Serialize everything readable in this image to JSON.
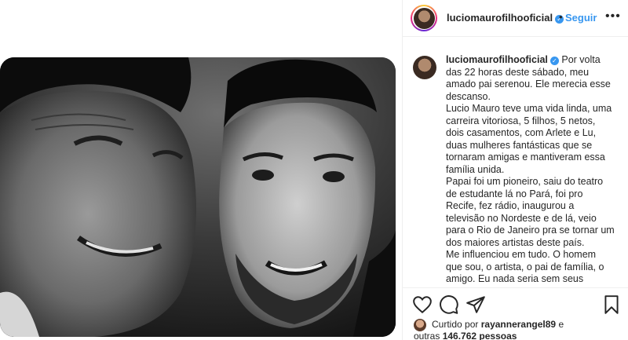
{
  "post": {
    "username": "luciomaurofilhooficial",
    "separator": "•",
    "follow_label": "Seguir",
    "more_label": "•••"
  },
  "caption": {
    "username": "luciomaurofilhooficial",
    "first_line": "Por volta",
    "lines": [
      "das 22 horas deste sábado, meu",
      "amado pai serenou. Ele merecia esse",
      "descanso.",
      "Lucio Mauro teve uma vida linda, uma",
      "carreira vitoriosa, 5 filhos, 5 netos,",
      "dois casamentos, com Arlete e Lu,",
      "duas mulheres fantásticas que se",
      "tornaram amigas e mantiveram essa",
      "família unida.",
      "Papai foi um pioneiro, saiu do teatro",
      "de estudante lá no Pará, foi pro",
      "Recife, fez rádio, inaugurou a",
      "televisão no Nordeste e de lá, veio",
      "para o Rio de Janeiro pra se tornar um",
      "dos maiores artistas deste país.",
      "Me influenciou em tudo. O homem",
      "que sou, o artista, o pai de família, o",
      "amigo. Eu nada seria sem seus"
    ]
  },
  "actions": {
    "like_icon": "heart-icon",
    "comment_icon": "comment-icon",
    "share_icon": "share-icon",
    "save_icon": "bookmark-icon"
  },
  "likes": {
    "prefix": "Curtido por",
    "liker": "rayannerangel89",
    "conj": "e",
    "others_prefix": "outras",
    "others_count": "146.762 pessoas"
  },
  "colors": {
    "accent": "#3897f0",
    "text": "#262626",
    "border": "#efefef"
  }
}
